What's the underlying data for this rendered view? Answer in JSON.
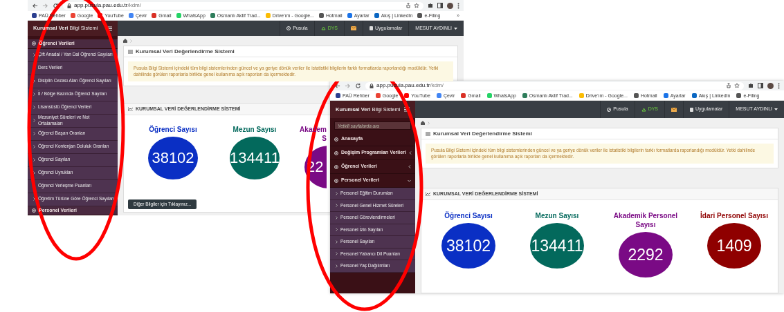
{
  "screenshots": [
    {
      "browser": {
        "url_host": "app.pusula.pau.edu.tr",
        "url_path": "/kdm/",
        "bookmarks": [
          {
            "label": "PAÜ Rehber",
            "color": "#2b3f8f"
          },
          {
            "label": "Google",
            "color": "#ea4335"
          },
          {
            "label": "YouTube",
            "color": "#ff0000"
          },
          {
            "label": "Çevir",
            "color": "#4285f4"
          },
          {
            "label": "Gmail",
            "color": "#d93025"
          },
          {
            "label": "WhatsApp",
            "color": "#25d366"
          },
          {
            "label": "Osmanlı Aktif Trad...",
            "color": "#2e7d5b"
          },
          {
            "label": "Drive'ım - Google...",
            "color": "#fbbc04"
          },
          {
            "label": "Hotmail",
            "color": "#555555"
          },
          {
            "label": "Ayarlar",
            "color": "#1a73e8"
          },
          {
            "label": "Akış | LinkedIn",
            "color": "#0a66c2"
          },
          {
            "label": "e-Filing",
            "color": "#555555"
          }
        ],
        "more": "»"
      },
      "app": {
        "brand": "**Kurumsal Veri** Bilgi Sistemi",
        "nav": [
          {
            "kind": "pusula",
            "label": "Pusula"
          },
          {
            "kind": "dys",
            "label": "DYS"
          },
          {
            "kind": "mail"
          },
          {
            "kind": "apps",
            "label": "Uygulamalar"
          },
          {
            "kind": "user",
            "label": "MESUT AYDINLI"
          }
        ]
      },
      "sidebar": {
        "items": [
          {
            "kind": "group",
            "label": "Öğrenci Verileri",
            "expanded": true,
            "children": [
              {
                "label": "Çift Anadal / Yan Dal Öğrenci Sayıları"
              },
              {
                "label": "Ders Verileri"
              },
              {
                "label": "Disiplin Cezası Alan Öğrenci Sayıları"
              },
              {
                "label": "İl / Bölge Bazında Öğrenci Sayıları"
              },
              {
                "label": "Lisansüstü Öğrenci Verileri"
              },
              {
                "label": "Mezuniyet Süreleri ve Not Ortalamaları"
              },
              {
                "label": "Öğrenci Başarı Oranları"
              },
              {
                "label": "Öğrenci Kontenjan Doluluk Oranları"
              },
              {
                "label": "Öğrenci Sayıları"
              },
              {
                "label": "Öğrenci Uyrukları"
              },
              {
                "label": "Öğrenci Yerleşme Puanları"
              },
              {
                "label": "Öğretim Türüne Göre Öğrenci Sayıları"
              }
            ]
          },
          {
            "kind": "group",
            "label": "Personel Verileri",
            "expanded": false
          }
        ]
      },
      "main": {
        "panel_title": "Kurumsal Veri Değerlendirme Sistemi",
        "notice": "Pusula Bilgi Sistemi içindeki tüm bilgi sistemlerinden güncel ve ya geriye dönük veriler ile istatistiki bilgilerin farklı formatlarda raporlandığı modüldür. Yetki dahilinde görülen raporlarla birlikte genel kullanıma açık raporları da içermektedir.",
        "stats_title": "KURUMSAL VERİ DEĞERLENDİRME SİSTEMİ",
        "stats": [
          {
            "lines": [
              "Öğrenci Sayısı"
            ],
            "value": "38102",
            "color": "#0a2fc4",
            "partial": false
          },
          {
            "lines": [
              "Mezun Sayısı"
            ],
            "value": "134411",
            "color": "#03695c",
            "partial": false
          },
          {
            "lines": [
              "Akadem",
              "S"
            ],
            "value": "22",
            "color": "#7a0a85",
            "partial": true
          }
        ],
        "more_button": "Diğer Bilgiler için Tıklayınız..."
      }
    },
    {
      "browser": {
        "url_host": "app.pusula.pau.edu.tr",
        "url_path": "/kdm/",
        "bookmarks": [
          {
            "label": "PAÜ Rehber",
            "color": "#2b3f8f"
          },
          {
            "label": "Google",
            "color": "#ea4335"
          },
          {
            "label": "YouTube",
            "color": "#ff0000"
          },
          {
            "label": "Çevir",
            "color": "#4285f4"
          },
          {
            "label": "Gmail",
            "color": "#d93025"
          },
          {
            "label": "WhatsApp",
            "color": "#25d366"
          },
          {
            "label": "Osmanlı Aktif Trad...",
            "color": "#2e7d5b"
          },
          {
            "label": "Drive'ım - Google...",
            "color": "#fbbc04"
          },
          {
            "label": "Hotmail",
            "color": "#555555"
          },
          {
            "label": "Ayarlar",
            "color": "#1a73e8"
          },
          {
            "label": "Akış | LinkedIn",
            "color": "#0a66c2"
          },
          {
            "label": "e-Filing",
            "color": "#555555"
          }
        ]
      },
      "app": {
        "brand": "**Kurumsal Veri** Bilgi Sistemi",
        "nav": [
          {
            "kind": "pusula",
            "label": "Pusula"
          },
          {
            "kind": "dys",
            "label": "DYS"
          },
          {
            "kind": "mail"
          },
          {
            "kind": "apps",
            "label": "Uygulamalar"
          },
          {
            "kind": "user",
            "label": "MESUT AYDINLI"
          }
        ]
      },
      "sidebar": {
        "search_placeholder": "Yetkili sayfalarda ara",
        "items": [
          {
            "kind": "link",
            "label": "Anasayfa"
          },
          {
            "kind": "group",
            "label": "Değişim Programları Verileri",
            "expanded": false
          },
          {
            "kind": "group",
            "label": "Öğrenci Verileri",
            "expanded": false
          },
          {
            "kind": "group",
            "label": "Personel Verileri",
            "expanded": true,
            "children": [
              {
                "label": "Personel Eğitim Durumları"
              },
              {
                "label": "Personel Genel Hizmet Süreleri"
              },
              {
                "label": "Personel Görevlendirmeleri"
              },
              {
                "label": "Personel İzin Sayıları"
              },
              {
                "label": "Personel Sayıları"
              },
              {
                "label": "Personel Yabancı Dil Puanları"
              },
              {
                "label": "Personel Yaş Dağılımları"
              }
            ]
          }
        ]
      },
      "main": {
        "panel_title": "Kurumsal Veri Değerlendirme Sistemi",
        "notice": "Pusula Bilgi Sistemi içindeki tüm bilgi sistemlerinden güncel ve ya geriye dönük veriler ile istatistiki bilgilerin farklı formatlarda raporlandığı modüldür. Yetki dahilinde görülen raporlarla birlikte genel kullanıma açık raporları da içermektedir.",
        "stats_title": "KURUMSAL VERİ DEĞERLENDİRME SİSTEMİ",
        "stats": [
          {
            "lines": [
              "Öğrenci Sayısı"
            ],
            "value": "38102",
            "color": "#0a2fc4",
            "partial": false
          },
          {
            "lines": [
              "Mezun Sayısı"
            ],
            "value": "134411",
            "color": "#03695c",
            "partial": false
          },
          {
            "lines": [
              "Akademik Personel",
              "Sayısı"
            ],
            "value": "2292",
            "color": "#7a0a85",
            "partial": false
          },
          {
            "lines": [
              "İdari Personel Sayısı"
            ],
            "value": "1409",
            "color": "#8f0000",
            "partial": false
          }
        ]
      }
    }
  ],
  "highlight_marks": [
    {
      "kind": "ellipse"
    },
    {
      "kind": "ellipse"
    }
  ]
}
